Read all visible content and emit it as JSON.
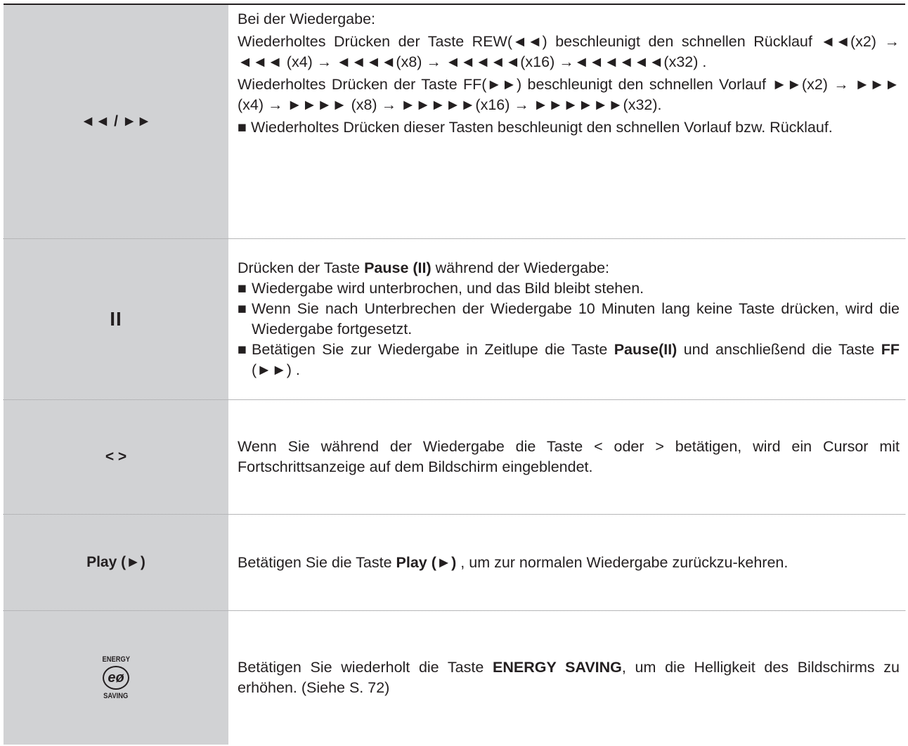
{
  "rows": [
    {
      "key": "◄◄ / ►►",
      "lines": [
        "Bei der Wiedergabe:",
        "Wiederholtes Drücken der Taste REW(◄◄) beschleunigt den schnellen Rücklauf ◄◄(x2) → ◄◄◄ (x4) → ◄◄◄◄(x8) → ◄◄◄◄◄(x16) →◄◄◄◄◄◄(x32) .",
        "Wiederholtes Drücken der Taste FF(►►) beschleunigt den schnellen Vorlauf ►►(x2) → ►►► (x4) → ►►►► (x8) → ►►►►►(x16) → ►►►►►►(x32).",
        "■ Wiederholtes Drücken dieser Tasten beschleunigt den schnellen Vorlauf bzw. Rücklauf."
      ]
    },
    {
      "key": "II",
      "intro_pre": "Drücken der Taste ",
      "intro_bold": "Pause (II)",
      "intro_post": " während der Wiedergabe:",
      "bullet_symbol": "■",
      "bullet1": "Wiedergabe wird unterbrochen, und das Bild bleibt stehen.",
      "bullet2": "Wenn Sie nach Unterbrechen der Wiedergabe 10 Minuten lang keine Taste drücken, wird die Wiedergabe fortgesetzt.",
      "bullet3_pre": "Betätigen Sie zur Wiedergabe in Zeitlupe die Taste ",
      "bullet3_bold1": "Pause(II)",
      "bullet3_mid": " und anschließend die Taste ",
      "bullet3_bold2": "FF",
      "bullet3_post": " (►►) ."
    },
    {
      "key": "< >",
      "text": "Wenn Sie während der Wiedergabe die Taste < oder > betätigen, wird ein Cursor mit Fortschrittsanzeige auf dem Bildschirm eingeblendet."
    },
    {
      "key": "Play (►)",
      "pre": "Betätigen Sie die Taste ",
      "bold": "Play (►)",
      "post": " , um zur normalen Wiedergabe zurückzu-kehren."
    },
    {
      "key_top": "ENERGY",
      "key_symbol": "eø",
      "key_bottom": "SAVING",
      "pre": "Betätigen Sie wiederholt die Taste ",
      "bold": "ENERGY SAVING",
      "post": ", um die Helligkeit des Bildschirms zu erhöhen. (Siehe S. 72)"
    }
  ]
}
